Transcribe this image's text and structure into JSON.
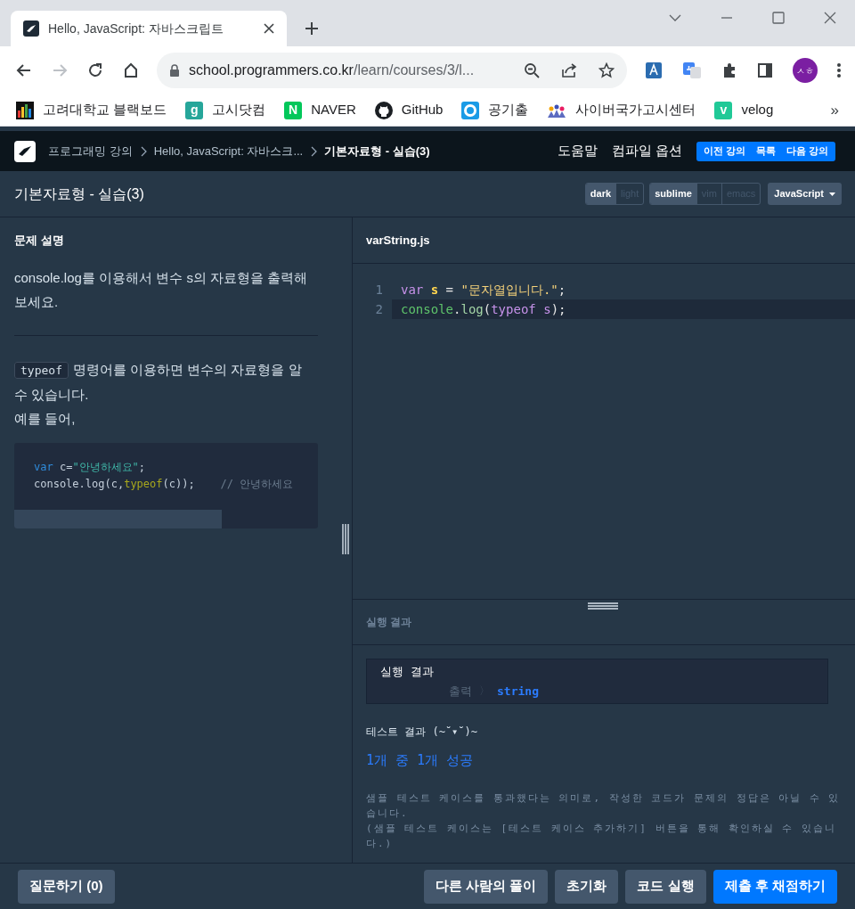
{
  "browser": {
    "tab": {
      "title": "Hello, JavaScript: 자바스크립트"
    },
    "address": {
      "host": "school.programmers.co.kr",
      "path": "/learn/courses/3/l..."
    },
    "nav": [
      {
        "kind": "back",
        "disabled": false
      },
      {
        "kind": "forward",
        "disabled": true
      },
      {
        "kind": "reload",
        "disabled": false
      },
      {
        "kind": "home",
        "disabled": false
      }
    ],
    "profile": {
      "initials": "ㅅㅎ",
      "color": "#7b1fa2"
    },
    "bookmarks": [
      {
        "label": "고려대학교 블랙보드",
        "kind": "bars"
      },
      {
        "label": "고시닷컴",
        "kind": "letter",
        "badge": "g",
        "color": "#26a69a"
      },
      {
        "label": "NAVER",
        "kind": "letter",
        "badge": "N",
        "color": "#03c75a"
      },
      {
        "label": "GitHub",
        "kind": "github"
      },
      {
        "label": "공기출",
        "kind": "ring"
      },
      {
        "label": "사이버국가고시센터",
        "kind": "crowd"
      },
      {
        "label": "velog",
        "kind": "letter",
        "badge": "v",
        "color": "#20c997"
      }
    ],
    "more": "»"
  },
  "header": {
    "breadcrumbs": [
      {
        "label": "프로그래밍 강의",
        "current": false
      },
      {
        "label": "Hello, JavaScript: 자바스크...",
        "current": false
      },
      {
        "label": "기본자료형 - 실습(3)",
        "current": true
      }
    ],
    "links": [
      "도움말",
      "컴파일 옵션"
    ],
    "lesson_nav": [
      "이전 강의",
      "목록",
      "다음 강의"
    ]
  },
  "toolbar": {
    "title": "기본자료형 - 실습(3)",
    "themes": [
      {
        "label": "dark",
        "selected": true
      },
      {
        "label": "light",
        "selected": false
      }
    ],
    "keymaps": [
      {
        "label": "sublime",
        "selected": true
      },
      {
        "label": "vim",
        "selected": false
      },
      {
        "label": "emacs",
        "selected": false
      }
    ],
    "language": "JavaScript"
  },
  "problem": {
    "heading": "문제 설명",
    "intro": "console.log를 이용해서 변수 s의 자료형을 출력해 보세요.",
    "hint": {
      "code": "typeof",
      "text": "명령어를 이용하면 변수의 자료형을 알 수 있습니다."
    },
    "example_intro": "예를 들어,",
    "example": [
      [
        {
          "text": "var",
          "kind": "keyword"
        },
        {
          "text": " c=",
          "kind": "plain"
        },
        {
          "text": "\"안녕하세요\"",
          "kind": "string"
        },
        {
          "text": ";",
          "kind": "plain"
        }
      ],
      [
        {
          "text": "console.log(c,",
          "kind": "plain"
        },
        {
          "text": "typeof",
          "kind": "func"
        },
        {
          "text": "(c));    ",
          "kind": "plain"
        },
        {
          "text": "// 안녕하세요",
          "kind": "comment"
        }
      ]
    ]
  },
  "editor": {
    "file": "varString.js",
    "lines": [
      {
        "number": "1",
        "active": false,
        "tokens": [
          {
            "text": "var ",
            "kind": "keyword"
          },
          {
            "text": "s",
            "kind": "variable"
          },
          {
            "text": " = ",
            "kind": "plain"
          },
          {
            "text": "\"문자열입니다.\"",
            "kind": "string"
          },
          {
            "text": ";",
            "kind": "plain"
          }
        ]
      },
      {
        "number": "2",
        "active": true,
        "tokens": [
          {
            "text": "console",
            "kind": "builtin"
          },
          {
            "text": ".",
            "kind": "plain"
          },
          {
            "text": "log",
            "kind": "func"
          },
          {
            "text": "(",
            "kind": "plain"
          },
          {
            "text": "typeof ",
            "kind": "keyword"
          },
          {
            "text": "s",
            "kind": "ident"
          },
          {
            "text": ");",
            "kind": "plain"
          }
        ]
      }
    ]
  },
  "result": {
    "heading": "실행 결과",
    "box": {
      "title": "실행 결과",
      "label": "출력",
      "separator": "〉",
      "value": "string"
    },
    "test_heading": "테스트 결과 (~˘▾˘)~",
    "summary": "1개 중 1개 성공",
    "notes": [
      "샘플 테스트 케이스를 통과했다는 의미로, 작성한 코드가 문제의 정답은 아닐 수 있습니다.",
      "(샘플 테스트 케이스는 [테스트 케이스 추가하기] 버튼을 통해 확인하실 수 있습니다.)"
    ]
  },
  "footer": {
    "left": [
      {
        "label": "질문하기 (0)",
        "kind": "secondary"
      }
    ],
    "right": [
      {
        "label": "다른 사람의 풀이",
        "kind": "secondary"
      },
      {
        "label": "초기화",
        "kind": "secondary"
      },
      {
        "label": "코드 실행",
        "kind": "secondary"
      },
      {
        "label": "제출 후 채점하기",
        "kind": "primary"
      }
    ]
  }
}
